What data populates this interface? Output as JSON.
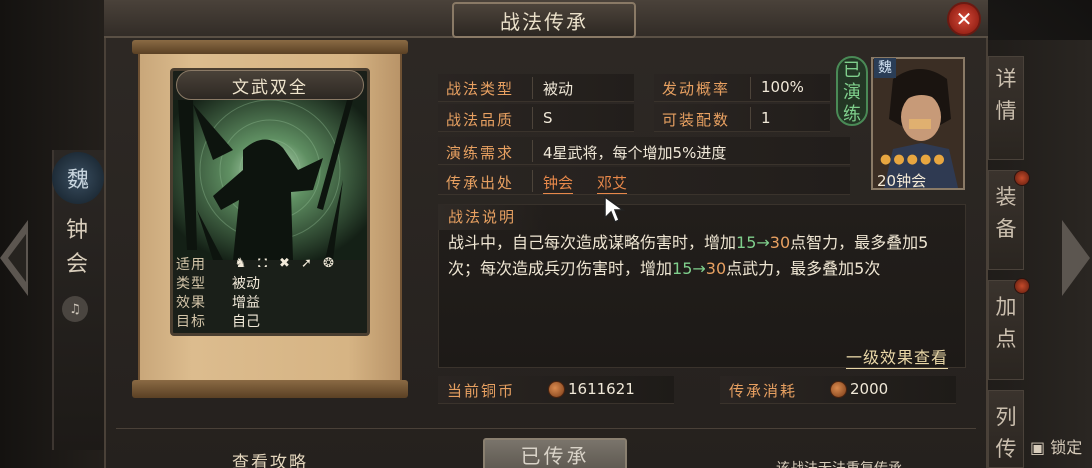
{
  "window": {
    "title": "战法传承",
    "close_icon": "close-icon"
  },
  "side_left": {
    "faction": "魏",
    "hero_name": "钟会",
    "sound_icon": "speaker-icon"
  },
  "side_right": {
    "tabs": [
      "详情",
      "装备",
      "加点",
      "列传"
    ],
    "lock_label": "锁定"
  },
  "skill_card": {
    "name": "文武双全",
    "rows": [
      {
        "key": "适用",
        "icons": [
          "cavalry-icon",
          "shield-icon",
          "bow-icon",
          "spear-icon",
          "siege-icon"
        ]
      },
      {
        "key": "类型",
        "value": "被动"
      },
      {
        "key": "效果",
        "value": "增益"
      },
      {
        "key": "目标",
        "value": "自己"
      }
    ]
  },
  "info": {
    "type_key": "战法类型",
    "type_val": "被动",
    "rate_key": "发动概率",
    "rate_val": "100%",
    "quality_key": "战法品质",
    "quality_val": "S",
    "slots_key": "可装配数",
    "slots_val": "1",
    "req_key": "演练需求",
    "req_val": "4星武将，每个增加5%进度",
    "source_key": "传承出处",
    "source_1": "钟会",
    "source_2": "邓艾"
  },
  "stamp": {
    "text": "已演练"
  },
  "portrait": {
    "faction": "魏",
    "stars": "●●●●●",
    "level": "20",
    "name": "钟会"
  },
  "description": {
    "title": "战法说明",
    "part1": "战斗中，自己每次造成谋略伤害时，增加",
    "a_low": "15",
    "arrow": "→",
    "a_high": "30",
    "part2": "点智力，最多叠加5次；每次造成兵刃伤害时，增加",
    "b_low": "15",
    "b_high": "30",
    "part3": "点武力，最多叠加5次"
  },
  "level_link": "一级效果查看",
  "currency": {
    "copper_key": "当前铜币",
    "copper_val": "1611621",
    "cost_key": "传承消耗",
    "cost_val": "2000"
  },
  "footer": {
    "guide": "查看攻略",
    "button": "已传承",
    "hint": "该战法无法重复传承"
  },
  "colors": {
    "accent_orange": "#e7a061",
    "green": "#7fcf8c",
    "close_red": "#c23a2c"
  }
}
